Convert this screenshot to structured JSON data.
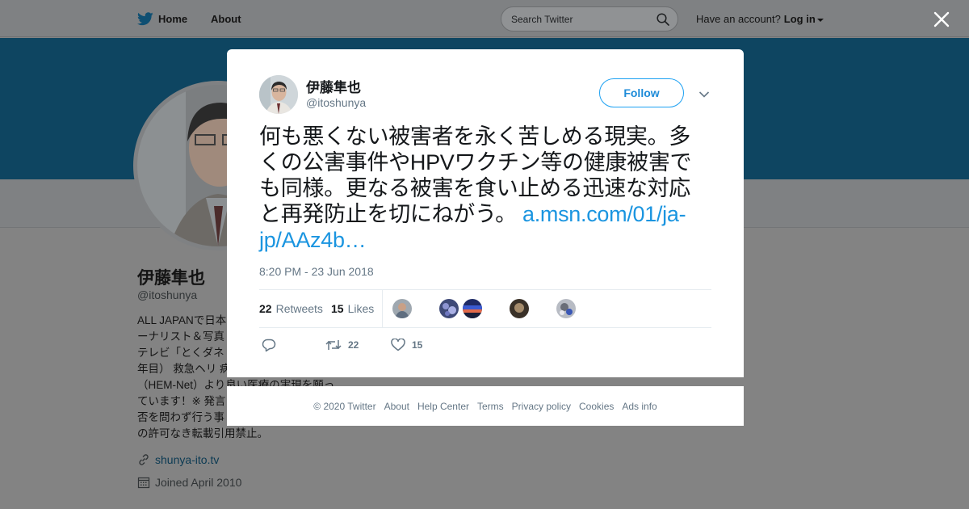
{
  "nav": {
    "home_label": "Home",
    "about_label": "About",
    "search_placeholder": "Search Twitter",
    "account_prompt": "Have an account?",
    "login_label": "Log in"
  },
  "profile": {
    "name": "伊藤隼也",
    "handle": "@itoshunya",
    "bio_lines": [
      "ALL JAPANで日本",
      "ーナリスト＆写真",
      "テレビ「とくダネ",
      "年目） 救急ヘリ 病",
      "（HEM-Net）より良い医療の実現を願っ",
      "ています！※ 発言",
      "否を問わず行う事",
      "の許可なき転載引用禁止。"
    ],
    "website": "shunya-ito.tv",
    "joined": "Joined April 2010"
  },
  "tweet": {
    "author_name": "伊藤隼也",
    "author_handle": "@itoshunya",
    "follow_label": "Follow",
    "text_lines": [
      "何も悪くない被害者を永く苦しめる現実。多",
      "くの公害事件やHPVワクチン等の健康被害で",
      "も同様。更なる被害を食い止める迅速な対応",
      "と再発防止を切にねがう。"
    ],
    "link_part1": "a.msn.com/01/ja-",
    "link_part2": "jp/AAz4b…",
    "timestamp": "8:20 PM - 23 Jun 2018",
    "retweets_count": "22",
    "retweets_label": "Retweets",
    "likes_count": "15",
    "likes_label": "Likes",
    "action_retweet_count": "22",
    "action_like_count": "15"
  },
  "footer": {
    "items": [
      "© 2020 Twitter",
      "About",
      "Help Center",
      "Terms",
      "Privacy policy",
      "Cookies",
      "Ads info"
    ]
  },
  "colors": {
    "twitter_blue": "#1da1f2",
    "link_blue": "#1b95e0",
    "banner": "#0e4561",
    "overlay": "#838383"
  },
  "icons": [
    "twitter-bird-icon",
    "search-icon",
    "caret-down-icon",
    "close-icon",
    "chevron-down-icon",
    "reply-icon",
    "retweet-icon",
    "heart-icon",
    "link-icon",
    "calendar-icon"
  ]
}
